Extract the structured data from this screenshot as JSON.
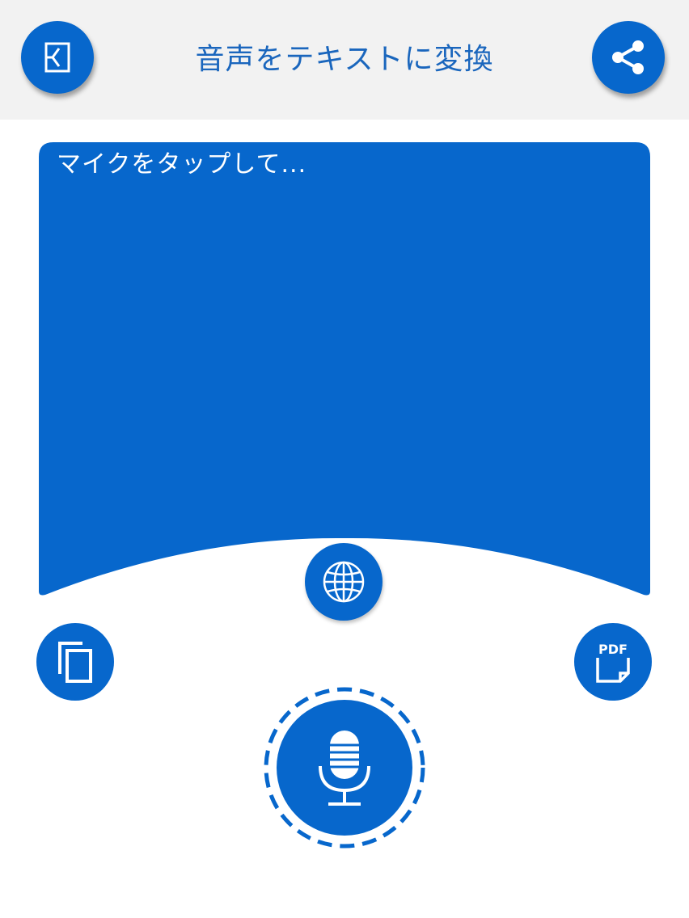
{
  "header": {
    "title": "音声をテキストに変換",
    "exit_icon": "exit-icon",
    "share_icon": "share-icon"
  },
  "text_area": {
    "placeholder": "マイクをタップして..."
  },
  "actions": {
    "language_icon": "globe-icon",
    "copy_icon": "copy-icon",
    "pdf_icon": "pdf-icon",
    "pdf_label": "PDF",
    "mic_icon": "microphone-icon"
  },
  "colors": {
    "accent": "#0767cc",
    "header_bg": "#f2f2f2",
    "title": "#1a66bd"
  }
}
